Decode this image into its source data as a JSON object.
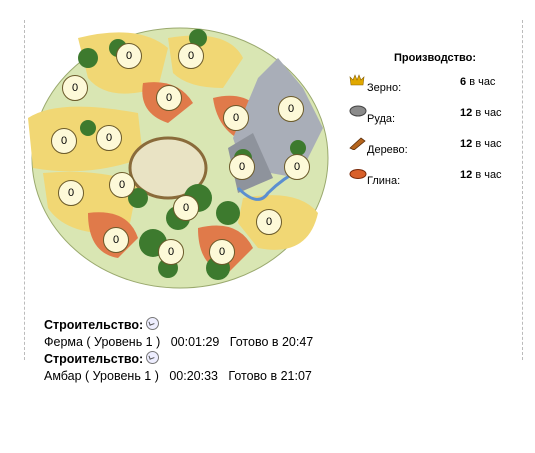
{
  "village": {
    "fields": [
      "0",
      "0",
      "0",
      "0",
      "0",
      "0",
      "0",
      "0",
      "0",
      "0",
      "0",
      "0",
      "0",
      "0",
      "0",
      "0",
      "0"
    ]
  },
  "production": {
    "title": "Производство:",
    "unit": "в час",
    "items": [
      {
        "icon": "crop-icon",
        "label": "Зерно:",
        "value": "6"
      },
      {
        "icon": "iron-icon",
        "label": "Руда:",
        "value": "12"
      },
      {
        "icon": "wood-icon",
        "label": "Дерево:",
        "value": "12"
      },
      {
        "icon": "clay-icon",
        "label": "Глина:",
        "value": "12"
      }
    ]
  },
  "construction": [
    {
      "heading": "Строительство:",
      "building": "Ферма ( Уровень 1 )",
      "time": "00:01:29",
      "done": "Готово в 20:47"
    },
    {
      "heading": "Строительство:",
      "building": "Амбар ( Уровень 1 )",
      "time": "00:20:33",
      "done": "Готово в 21:07"
    }
  ]
}
